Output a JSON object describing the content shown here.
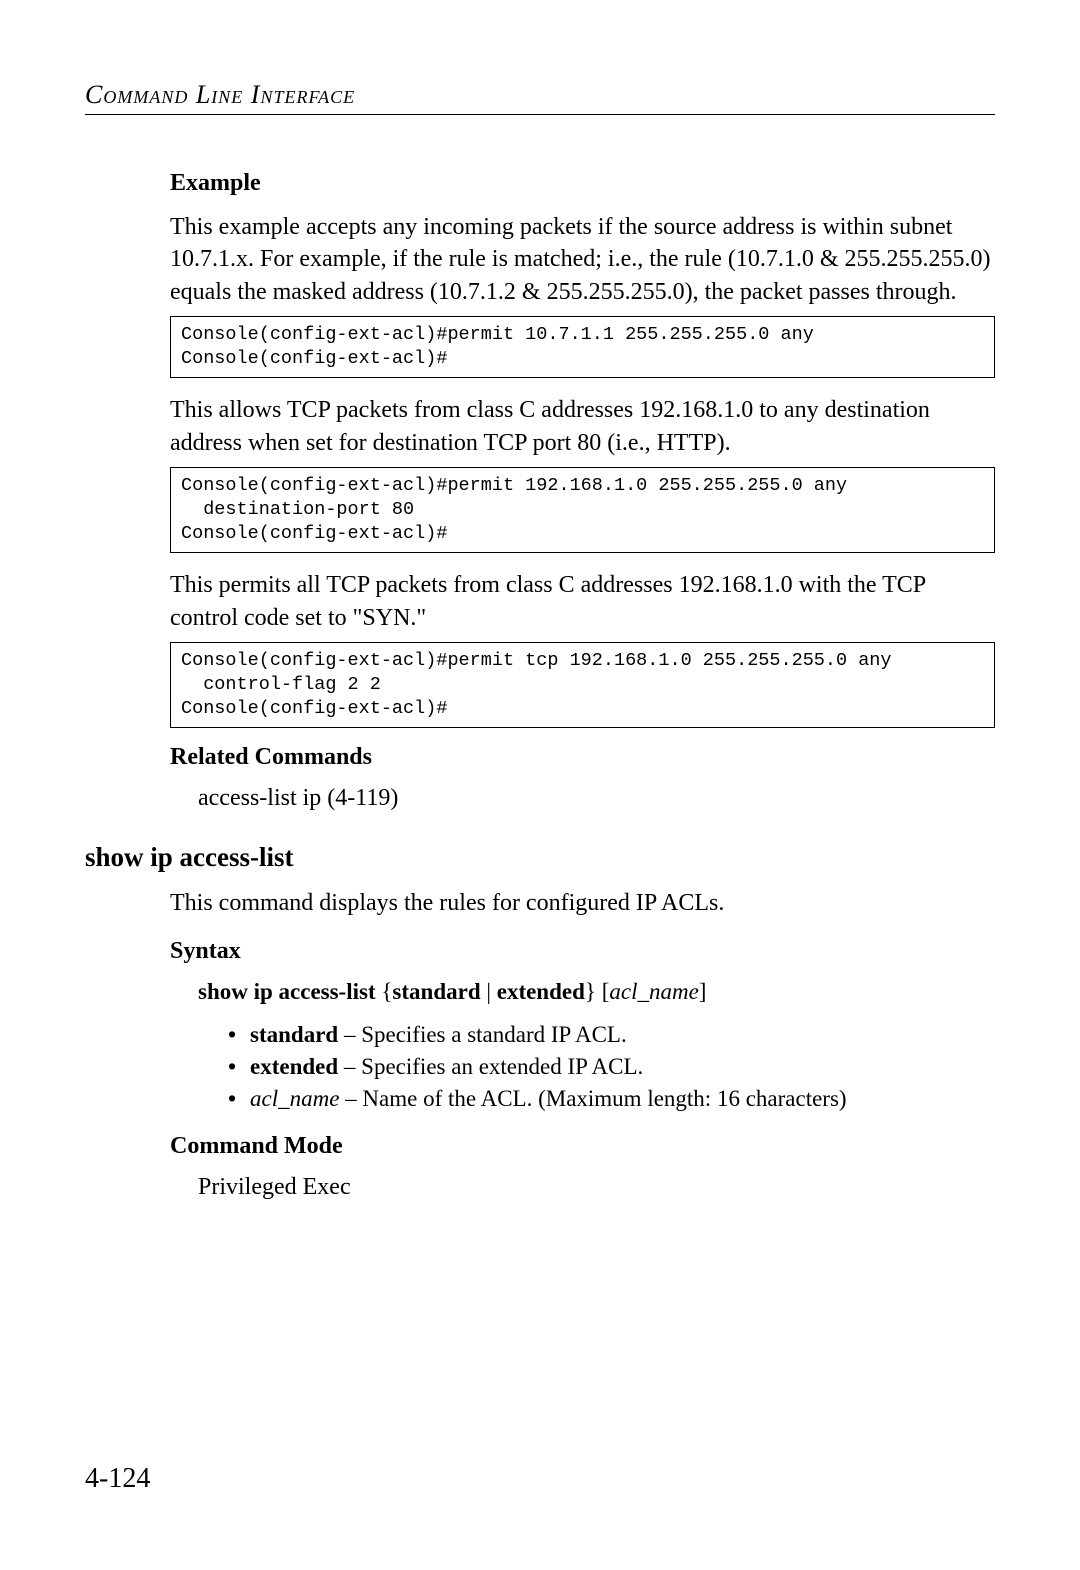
{
  "header": {
    "title": "Command Line Interface"
  },
  "example": {
    "label": "Example",
    "para1": "This example accepts any incoming packets if the source address is within subnet 10.7.1.x. For example, if the rule is matched; i.e., the rule (10.7.1.0 & 255.255.255.0) equals the masked address (10.7.1.2 & 255.255.255.0), the packet passes through.",
    "code1": "Console(config-ext-acl)#permit 10.7.1.1 255.255.255.0 any\nConsole(config-ext-acl)#",
    "para2": "This allows TCP packets from class C addresses 192.168.1.0 to any destination address when set for destination TCP port 80 (i.e., HTTP).",
    "code2": "Console(config-ext-acl)#permit 192.168.1.0 255.255.255.0 any \n  destination-port 80\nConsole(config-ext-acl)#",
    "para3": "This permits all TCP packets from class C addresses 192.168.1.0 with the TCP control code set to \"SYN.\"",
    "code3": "Console(config-ext-acl)#permit tcp 192.168.1.0 255.255.255.0 any \n  control-flag 2 2\nConsole(config-ext-acl)#"
  },
  "related": {
    "label": "Related Commands",
    "item": "access-list ip (4-119)"
  },
  "command": {
    "heading": "show ip access-list",
    "description": "This command displays the rules for configured IP ACLs.",
    "syntax_label": "Syntax",
    "syntax_cmd": "show ip access-list",
    "syntax_braces_open": " {",
    "syntax_opt1": "standard",
    "syntax_pipe": " | ",
    "syntax_opt2": "extended",
    "syntax_braces_close": "}",
    "syntax_bracket_open": " [",
    "syntax_param": "acl_name",
    "syntax_bracket_close": "]",
    "bullets": [
      {
        "bold": "standard",
        "text": " – Specifies a standard IP ACL."
      },
      {
        "bold": "extended",
        "text": " – Specifies an extended IP ACL."
      },
      {
        "italic": "acl_name",
        "text": " – Name of the ACL. (Maximum length: 16 characters)"
      }
    ],
    "mode_label": "Command Mode",
    "mode_text": "Privileged Exec"
  },
  "page_number": "4-124"
}
